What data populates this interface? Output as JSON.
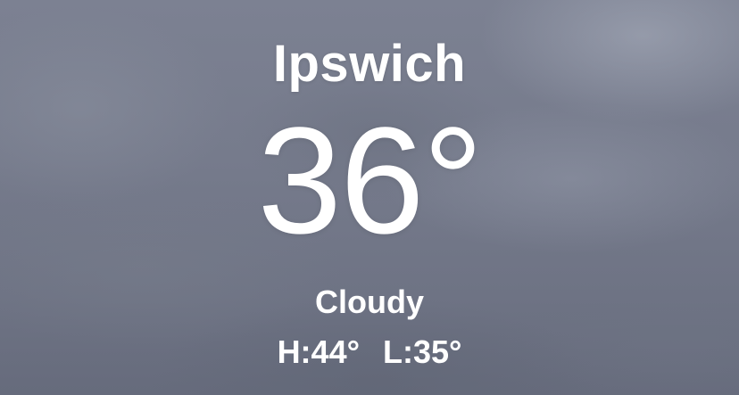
{
  "weather": {
    "city": "Ipswich",
    "temperature": "36°",
    "condition": "Cloudy",
    "high": "H:44°",
    "low": "L:35°"
  },
  "colors": {
    "text": "#ffffff",
    "sky": "#767b8c"
  }
}
